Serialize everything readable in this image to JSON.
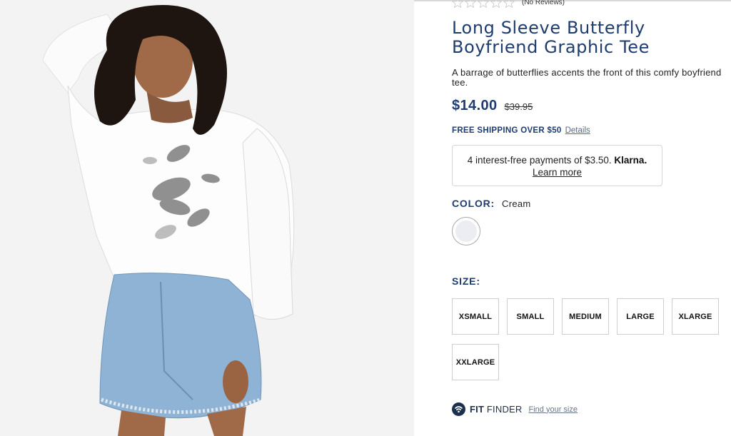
{
  "product": {
    "reviews_text": "(No Reviews)",
    "rating_stars": 0,
    "rating_max": 5,
    "title": "Long Sleeve Butterfly Boyfriend Graphic Tee",
    "description": "A barrage of butterflies accents the front of this comfy boyfriend tee.",
    "price": "$14.00",
    "original_price": "$39.95"
  },
  "shipping": {
    "text": "FREE SHIPPING OVER $50",
    "details_link": "Details"
  },
  "klarna": {
    "text": "4 interest-free payments of $3.50.",
    "brand": "Klarna.",
    "learn_more": "Learn more"
  },
  "color": {
    "label": "COLOR:",
    "value": "Cream",
    "swatch_color": "#ecedf3"
  },
  "size": {
    "label": "SIZE:",
    "options": [
      "XSMALL",
      "SMALL",
      "MEDIUM",
      "LARGE",
      "XLARGE",
      "XXLARGE"
    ]
  },
  "fit_finder": {
    "brand_bold": "FIT",
    "brand_rest": "FINDER",
    "link": "Find your size",
    "icon": "fit-finder-icon"
  },
  "colors": {
    "accent": "#1f3c6e",
    "text": "#222222",
    "border": "#cfcfcf"
  }
}
